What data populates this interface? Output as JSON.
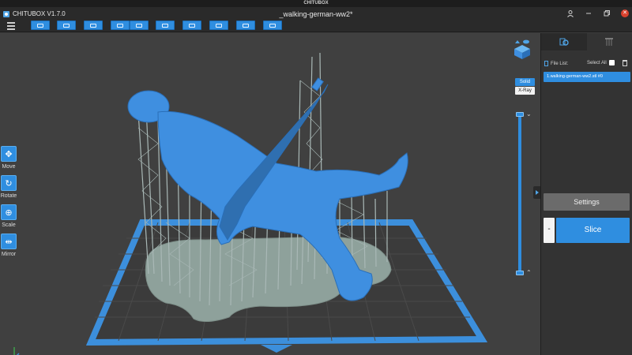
{
  "app": {
    "window_title": "CHITUBOX",
    "brand": "CHITUBOX V1.7.0",
    "file_title": "_walking-german-ww2*"
  },
  "window_controls": [
    "user-icon",
    "minimize-icon",
    "restore-icon",
    "close-icon"
  ],
  "toolbar": {
    "buttons": [
      "open-file-icon",
      "save-file-icon",
      "delete-icon",
      "undo-icon",
      "redo-icon",
      "camera-icon",
      "support-icon",
      "fill-icon",
      "layout-icon",
      "hollow-icon"
    ]
  },
  "left_tools": [
    {
      "label": "Move",
      "icon": "move-icon"
    },
    {
      "label": "Rotate",
      "icon": "rotate-icon"
    },
    {
      "label": "Scale",
      "icon": "scale-icon"
    },
    {
      "label": "Mirror",
      "icon": "mirror-icon"
    }
  ],
  "view_modes": {
    "solid": "Solid",
    "xray": "X-Ray",
    "active": "Solid"
  },
  "right_panel": {
    "tabs": [
      "settings-gear-icon",
      "support-structure-icon"
    ],
    "file_list_label": "File List:",
    "select_all_label": "Select All",
    "files": [
      "1.walking-german-ww2.stl #0"
    ],
    "settings_label": "Settings",
    "minus_label": "-",
    "slice_label": "Slice"
  },
  "colors": {
    "accent": "#2f8ee0",
    "model": "#3f8fe0",
    "supports": "#a9b8b6",
    "raft": "#8ea19b",
    "plate_border": "#3c8fdc",
    "close": "#d9412d"
  }
}
